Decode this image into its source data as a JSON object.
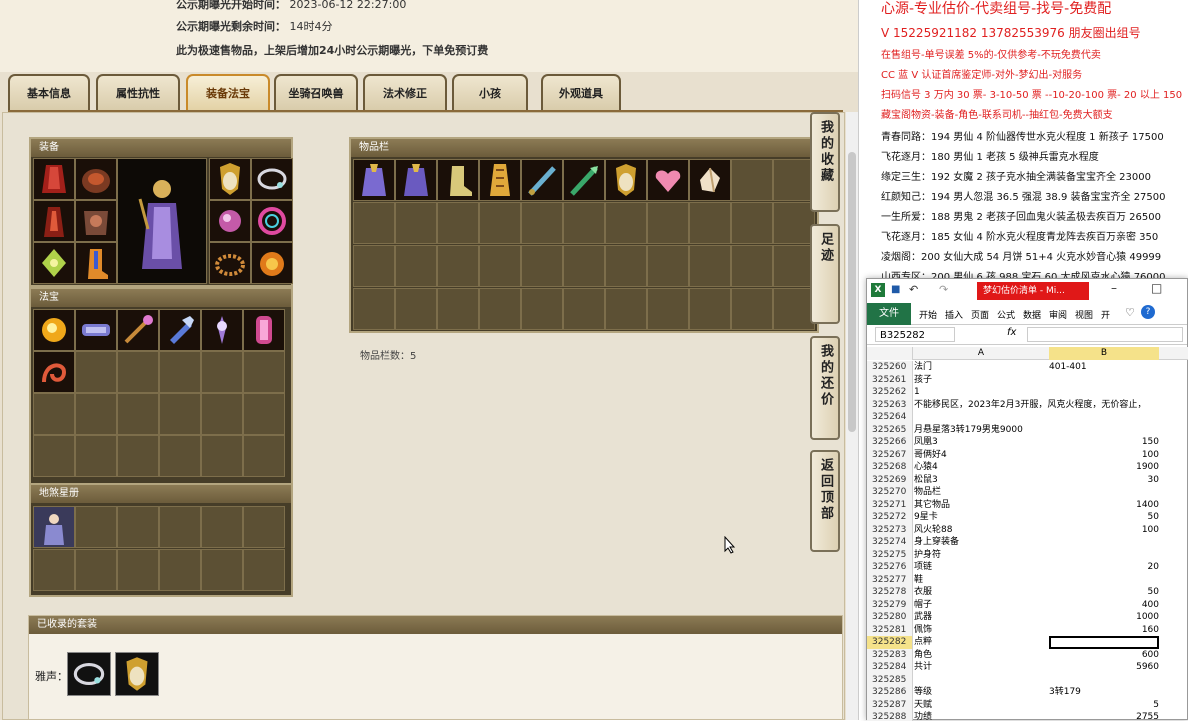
{
  "header": {
    "line1_label": "公示期曝光开始时间：",
    "line1_value": "2023-06-12 22:27:00",
    "line2_label": "公示期曝光剩余时间：",
    "line2_value": "14时4分",
    "notice": "此为极速售物品，上架后增加24小时公示期曝光，下单免预订费"
  },
  "tabs": [
    {
      "label": "基本信息"
    },
    {
      "label": "属性抗性"
    },
    {
      "label": "装备法宝"
    },
    {
      "label": "坐骑召唤兽"
    },
    {
      "label": "法术修正"
    },
    {
      "label": "小孩"
    },
    {
      "label": "外观道具"
    }
  ],
  "active_tab": "装备法宝",
  "panels": {
    "equipment": "装备",
    "treasure": "法宝",
    "inventory": "物品栏",
    "underworld": "地煞星册",
    "inventory_count": "物品栏数：5"
  },
  "side_buttons": [
    {
      "label": "我的收藏"
    },
    {
      "label": "足迹"
    },
    {
      "label": "我的还价"
    },
    {
      "label": "返回顶部"
    }
  ],
  "suits": {
    "title": "已收录的套装",
    "label": "雅声："
  },
  "ads": [
    "心源-专业估价-代卖组号-找号-免费配",
    "V 15225921182   13782553976 朋友圈出组号",
    "在售组号-单号误差 5%的-仅供参考-不玩免费代卖",
    "CC 蓝 V 认证首席鉴定师-对外-梦幻出-对服务",
    "扫码信号 3 万内 30 票- 3-10-50 票  --10-20-100 票- 20 以上 150",
    "藏宝阁物资-装备-角色-联系司机--抽红包-免费大额支"
  ],
  "notes": [
    "青春同路：194 男仙 4 阶仙器传世水克火程度 1 新孩子 17500",
    "飞花逐月：180 男仙 1 老孩 5 级神兵雷克水程度",
    "缘定三生：192 女魔 2 孩子克水抽全满装备宝宝齐全 23000",
    "红颜知己：194 男人忽混 36.5 强混 38.9 装备宝宝齐全 27500",
    "一生所爱：188 男鬼 2 老孩子回血鬼火装孟极去疾百万 26500",
    "飞花逐月：185 女仙 4 阶水克火程度青龙阵去疾百万亲密 350",
    "凌烟阁：200 女仙大成 54 月饼 51+4 火克水妙音心猿 49999",
    "山西专区：200 男仙 6 孩 988 宝石 60 大成风克水心猿 76000"
  ],
  "excel": {
    "title": "梦幻估价清单 - Mi...",
    "ribbon": [
      "文件",
      "开始",
      "插入",
      "页面",
      "公式",
      "数据",
      "审阅",
      "视图",
      "开"
    ],
    "name_box": "B325282",
    "fx": "fx",
    "col_a": "A",
    "col_b": "B",
    "rows": [
      {
        "n": "325260",
        "a": "法门",
        "b": "401-401",
        "r": false
      },
      {
        "n": "325261",
        "a": "孩子",
        "b": "",
        "r": false
      },
      {
        "n": "325262",
        "a": "1",
        "b": "",
        "r": false
      },
      {
        "n": "325263",
        "a": "不能移民区，2023年2月3开服，风克火程度，无价容止，",
        "b": "",
        "r": false
      },
      {
        "n": "325264",
        "a": "",
        "b": "",
        "r": false
      },
      {
        "n": "325265",
        "a": "月悬星落3转179男鬼9000",
        "b": "",
        "r": false
      },
      {
        "n": "325266",
        "a": "凤凰3",
        "b": "150",
        "r": true
      },
      {
        "n": "325267",
        "a": "哥俩好4",
        "b": "100",
        "r": true
      },
      {
        "n": "325268",
        "a": "心猿4",
        "b": "1900",
        "r": true
      },
      {
        "n": "325269",
        "a": "松鼠3",
        "b": "30",
        "r": true
      },
      {
        "n": "325270",
        "a": "物品栏",
        "b": "",
        "r": false
      },
      {
        "n": "325271",
        "a": "其它物品",
        "b": "1400",
        "r": true
      },
      {
        "n": "325272",
        "a": "9星卡",
        "b": "50",
        "r": true
      },
      {
        "n": "325273",
        "a": "风火轮88",
        "b": "100",
        "r": true
      },
      {
        "n": "325274",
        "a": "身上穿装备",
        "b": "",
        "r": false
      },
      {
        "n": "325275",
        "a": "护身符",
        "b": "",
        "r": false
      },
      {
        "n": "325276",
        "a": "项链",
        "b": "20",
        "r": true
      },
      {
        "n": "325277",
        "a": "鞋",
        "b": "",
        "r": false
      },
      {
        "n": "325278",
        "a": "衣服",
        "b": "50",
        "r": true
      },
      {
        "n": "325279",
        "a": "帽子",
        "b": "400",
        "r": true
      },
      {
        "n": "325280",
        "a": "武器",
        "b": "1000",
        "r": true
      },
      {
        "n": "325281",
        "a": "佩饰",
        "b": "160",
        "r": true
      },
      {
        "n": "325282",
        "a": "点粹",
        "b": "",
        "r": false
      },
      {
        "n": "325283",
        "a": "角色",
        "b": "600",
        "r": true
      },
      {
        "n": "325284",
        "a": "共计",
        "b": "5960",
        "r": true
      },
      {
        "n": "325285",
        "a": "",
        "b": "",
        "r": false
      },
      {
        "n": "325286",
        "a": "等级",
        "b": "3转179",
        "r": false
      },
      {
        "n": "325287",
        "a": "天赋",
        "b": "5",
        "r": true
      },
      {
        "n": "325288",
        "a": "功绩",
        "b": "2755",
        "r": true
      }
    ]
  },
  "colors": {
    "accent": "#c98a2a",
    "panel_bg": "#463d28",
    "slot_border": "#7d6e4b",
    "ad_red": "#e02020"
  }
}
